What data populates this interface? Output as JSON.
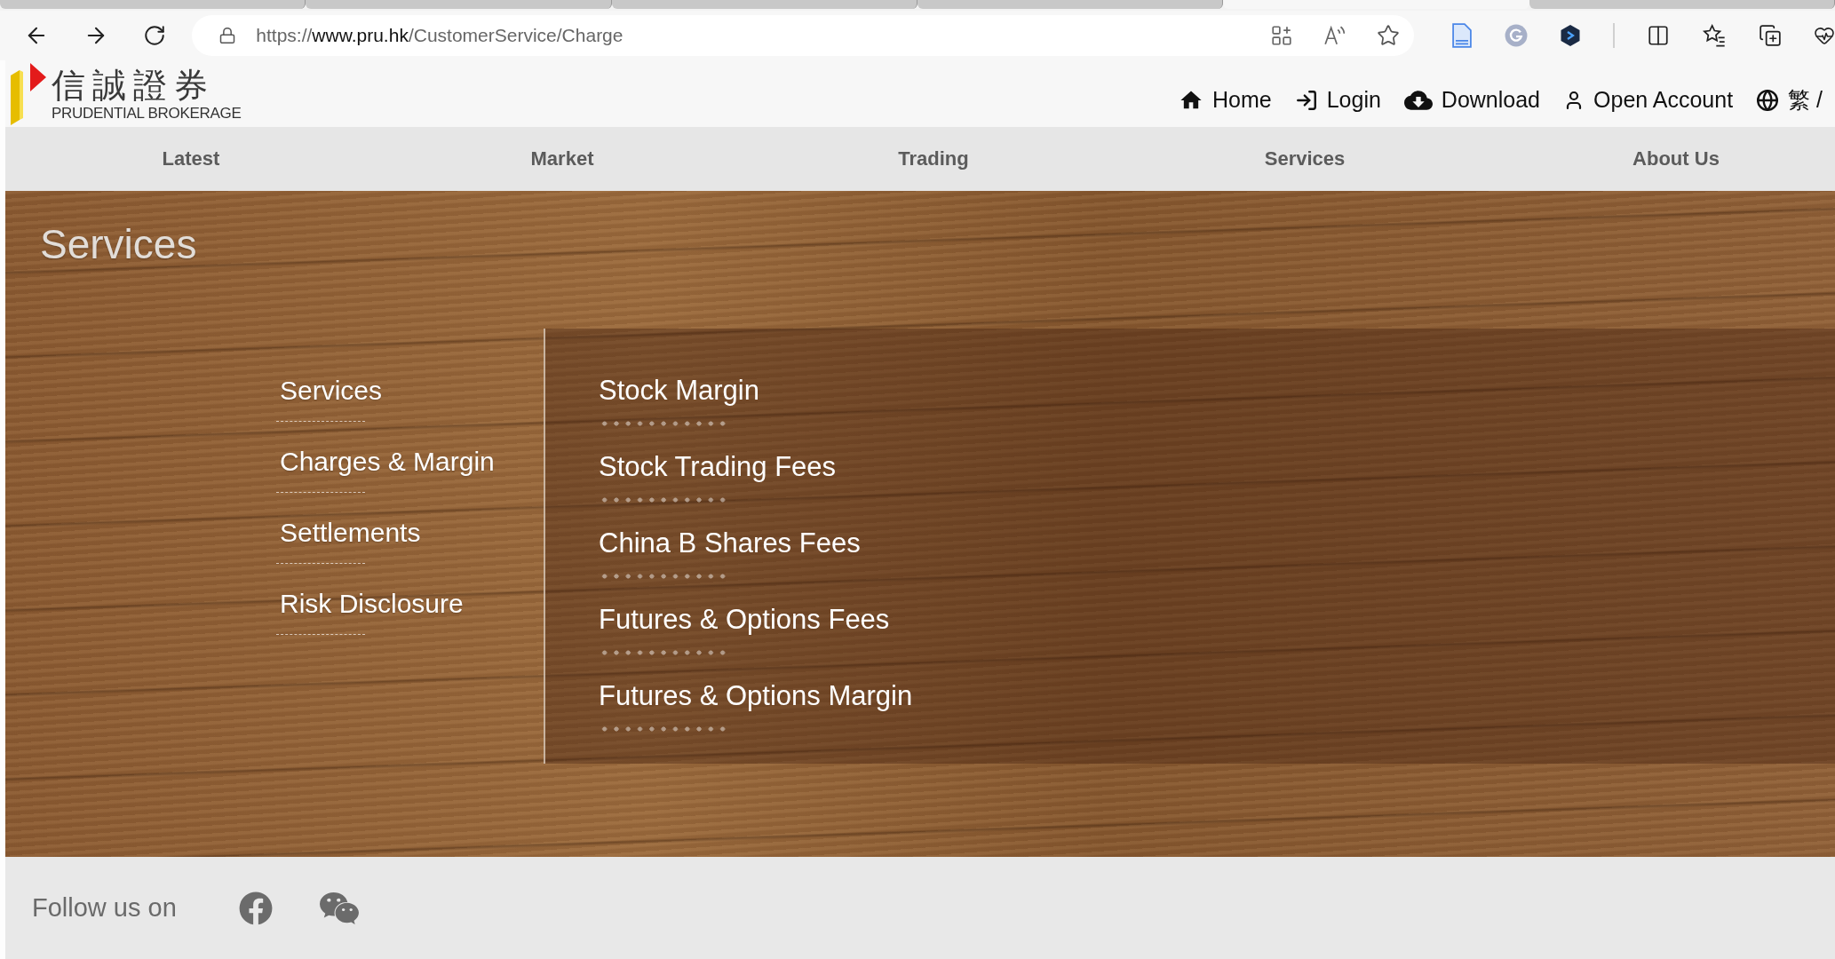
{
  "browser": {
    "tabs": [
      {
        "selected": false
      },
      {
        "selected": false
      },
      {
        "selected": false
      },
      {
        "selected": false
      },
      {
        "selected": true
      },
      {
        "selected": false
      }
    ],
    "url": {
      "scheme": "https://",
      "host": "www.pru.hk",
      "path": "/CustomerService/Charge"
    }
  },
  "header": {
    "logo": {
      "chinese": "信誠證券",
      "english": "PRUDENTIAL BROKERAGE"
    },
    "links": [
      "Home",
      "Login",
      "Download",
      "Open Account",
      "繁 /"
    ]
  },
  "main_nav": [
    "Latest",
    "Market",
    "Trading",
    "Services",
    "About Us"
  ],
  "hero": {
    "title": "Services",
    "side_menu": [
      "Services",
      "Charges & Margin",
      "Settlements",
      "Risk Disclosure"
    ],
    "submenu": [
      "Stock Margin",
      "Stock Trading Fees",
      "China B Shares Fees",
      "Futures & Options Fees",
      "Futures & Options Margin"
    ]
  },
  "footer": {
    "follow_label": "Follow us on"
  }
}
